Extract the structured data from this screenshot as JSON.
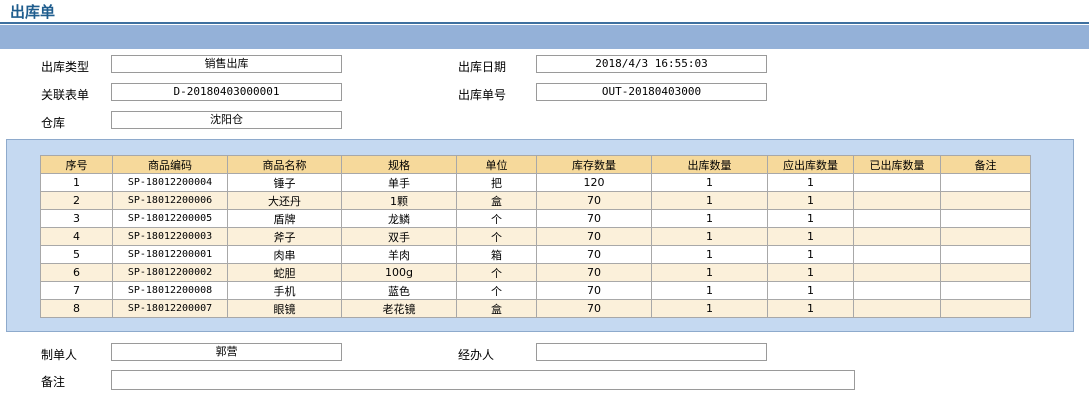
{
  "page": {
    "title": "出库单"
  },
  "form": {
    "outbound_type": {
      "label": "出库类型",
      "value": "销售出库"
    },
    "outbound_date": {
      "label": "出库日期",
      "value": "2018/4/3 16:55:03"
    },
    "related_order": {
      "label": "关联表单",
      "value": "D-20180403000001"
    },
    "outbound_no": {
      "label": "出库单号",
      "value": "OUT-20180403000"
    },
    "warehouse": {
      "label": "仓库",
      "value": "沈阳仓"
    },
    "creator": {
      "label": "制单人",
      "value": "郭营"
    },
    "handler": {
      "label": "经办人",
      "value": ""
    },
    "remark": {
      "label": "备注",
      "value": ""
    }
  },
  "grid": {
    "columns": [
      "序号",
      "商品编码",
      "商品名称",
      "规格",
      "单位",
      "库存数量",
      "出库数量",
      "应出库数量",
      "已出库数量",
      "备注"
    ],
    "rows": [
      [
        "1",
        "SP-18012200004",
        "锤子",
        "单手",
        "把",
        "120",
        "1",
        "1",
        "",
        ""
      ],
      [
        "2",
        "SP-18012200006",
        "大还丹",
        "1颗",
        "盒",
        "70",
        "1",
        "1",
        "",
        ""
      ],
      [
        "3",
        "SP-18012200005",
        "盾牌",
        "龙鳞",
        "个",
        "70",
        "1",
        "1",
        "",
        ""
      ],
      [
        "4",
        "SP-18012200003",
        "斧子",
        "双手",
        "个",
        "70",
        "1",
        "1",
        "",
        ""
      ],
      [
        "5",
        "SP-18012200001",
        "肉串",
        "羊肉",
        "箱",
        "70",
        "1",
        "1",
        "",
        ""
      ],
      [
        "6",
        "SP-18012200002",
        "蛇胆",
        "100g",
        "个",
        "70",
        "1",
        "1",
        "",
        ""
      ],
      [
        "7",
        "SP-18012200008",
        "手机",
        "蓝色",
        "个",
        "70",
        "1",
        "1",
        "",
        ""
      ],
      [
        "8",
        "SP-18012200007",
        "眼镜",
        "老花镜",
        "盒",
        "70",
        "1",
        "1",
        "",
        ""
      ]
    ]
  },
  "colors": {
    "title": "#1f5d8e",
    "band": "#94b1d8",
    "panel": "#c5d9f1",
    "header": "#f6d99b",
    "alt_row": "#fbf0da"
  }
}
